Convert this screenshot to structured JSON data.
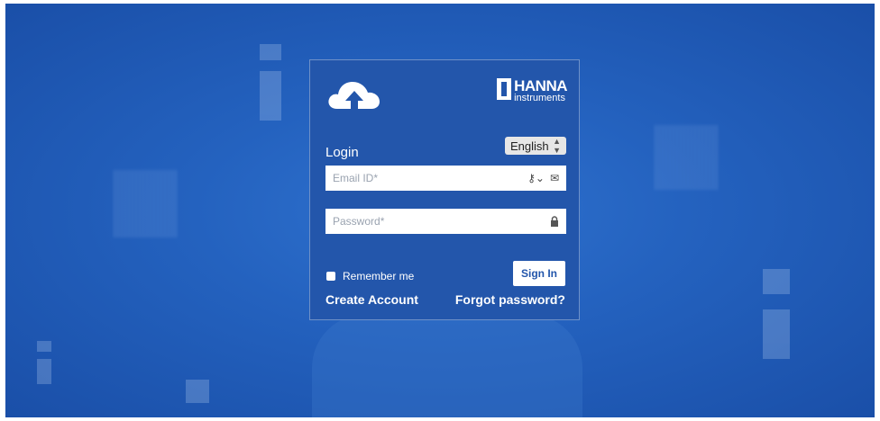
{
  "brand": {
    "name": "HANNA",
    "sub": "instruments"
  },
  "login": {
    "title": "Login",
    "language": "English",
    "email_placeholder": "Email ID*",
    "password_placeholder": "Password*",
    "remember_label": "Remember me",
    "signin_label": "Sign In",
    "create_account": "Create Account",
    "forgot_password": "Forgot password?"
  },
  "colors": {
    "card_bg": "#2356ab",
    "page_bg": "#2462bf",
    "button_text": "#2356ab"
  },
  "icons": {
    "logo": "cloud-upload-icon",
    "key": "key-icon",
    "email": "envelope-icon",
    "password": "lock-icon",
    "language": "select-arrows-icon"
  }
}
